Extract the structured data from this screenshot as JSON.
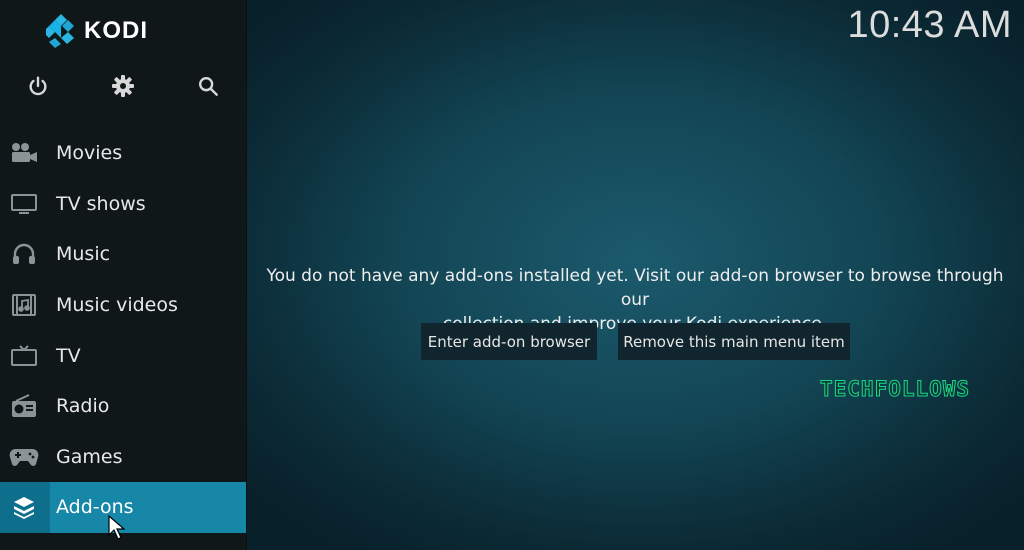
{
  "app": {
    "logo_text": "KODI",
    "clock": "10:43 AM"
  },
  "topicons": [
    {
      "name": "power-icon"
    },
    {
      "name": "settings-icon"
    },
    {
      "name": "search-icon"
    }
  ],
  "menu": {
    "items": [
      {
        "label": "Movies",
        "icon": "movies-icon",
        "active": false
      },
      {
        "label": "TV shows",
        "icon": "tv-shows-icon",
        "active": false
      },
      {
        "label": "Music",
        "icon": "headphones-icon",
        "active": false
      },
      {
        "label": "Music videos",
        "icon": "music-videos-icon",
        "active": false
      },
      {
        "label": "TV",
        "icon": "tv-icon",
        "active": false
      },
      {
        "label": "Radio",
        "icon": "radio-icon",
        "active": false
      },
      {
        "label": "Games",
        "icon": "gamepad-icon",
        "active": false
      },
      {
        "label": "Add-ons",
        "icon": "addons-icon",
        "active": true
      }
    ]
  },
  "main": {
    "message_line1": "You do not have any add-ons installed yet. Visit our add-on browser to browse through our",
    "message_line2": "collection and improve your Kodi experience.",
    "button_browser": "Enter add-on browser",
    "button_remove": "Remove this main menu item",
    "watermark": "TECHFOLLOWS"
  },
  "colors": {
    "accent": "#1687a7",
    "sidebar_bg": "#101719",
    "background": "#134655"
  }
}
